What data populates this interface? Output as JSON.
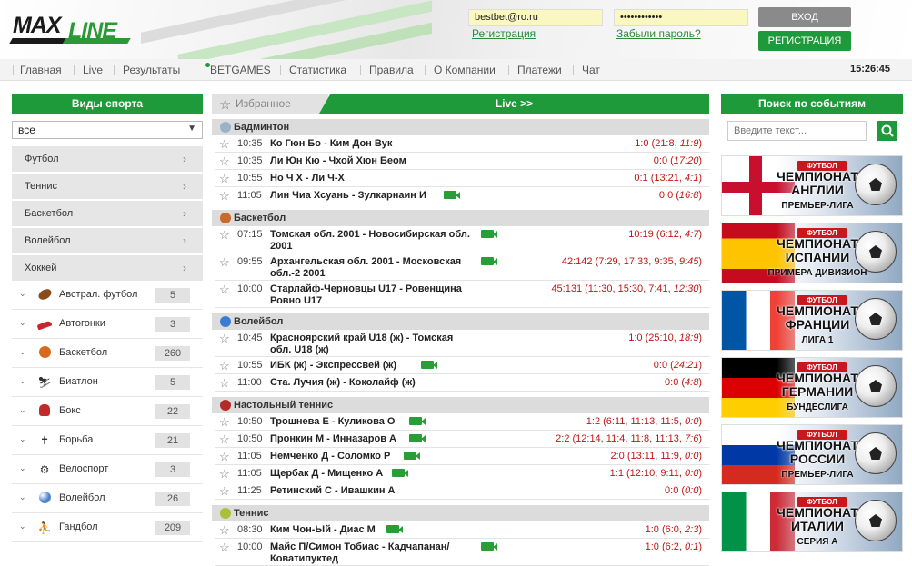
{
  "header": {
    "logo_max": "MAX",
    "logo_line": "LINE",
    "login_value": "bestbet@ro.ru",
    "password_value": "••••••••••••",
    "register_link": "Регистрация",
    "forgot_link": "Забыли пароль?",
    "login_button": "ВХОД",
    "register_button": "РЕГИСТРАЦИЯ",
    "colors": {
      "accent": "#1f9a3a",
      "login_btn": "#8a8a8a",
      "input_bg": "#fbf7c0"
    }
  },
  "nav": {
    "items": [
      "Главная",
      "Live",
      "Результаты",
      "BETGAMES",
      "Статистика",
      "Правила",
      "О Компании",
      "Платежи",
      "Чат"
    ],
    "clock": "15:26:45"
  },
  "left": {
    "title": "Виды спорта",
    "select_value": "все",
    "categories": [
      "Футбол",
      "Теннис",
      "Баскетбол",
      "Волейбол",
      "Хоккей"
    ],
    "sports": [
      {
        "label": "Австрал. футбол",
        "count": "5",
        "icon": "rugby-ball-icon"
      },
      {
        "label": "Автогонки",
        "count": "3",
        "icon": "race-car-icon"
      },
      {
        "label": "Баскетбол",
        "count": "260",
        "icon": "basketball-icon"
      },
      {
        "label": "Биатлон",
        "count": "5",
        "icon": "biathlon-icon"
      },
      {
        "label": "Бокс",
        "count": "22",
        "icon": "boxing-glove-icon"
      },
      {
        "label": "Борьба",
        "count": "21",
        "icon": "wrestling-icon"
      },
      {
        "label": "Велоспорт",
        "count": "3",
        "icon": "bicycle-icon"
      },
      {
        "label": "Волейбол",
        "count": "26",
        "icon": "volleyball-icon"
      },
      {
        "label": "Гандбол",
        "count": "209",
        "icon": "handball-icon"
      }
    ]
  },
  "mid": {
    "tab_fav": "Избранное",
    "tab_live": "Live >>",
    "sections": [
      {
        "title": "Бадминтон",
        "events": [
          {
            "time": "10:35",
            "teams": "Ко Гюн Бо - Ким Дон Вук",
            "score": "1:0 (21:8, ",
            "score_live": "11:9",
            "score_end": ")",
            "video": false
          },
          {
            "time": "10:35",
            "teams": "Ли Юн Кю - Чхой Хюн Беом",
            "score": "0:0 (",
            "score_live": "17:20",
            "score_end": ")",
            "video": false
          },
          {
            "time": "10:55",
            "teams": "Но Ч Х - Ли Ч-Х",
            "score": "0:1 (13:21, ",
            "score_live": "4:1",
            "score_end": ")",
            "video": false
          },
          {
            "time": "11:05",
            "teams": "Лин Чиа Хсуань - Зулкарнаин И",
            "score": "0:0 (",
            "score_live": "16:8",
            "score_end": ")",
            "video": true
          }
        ]
      },
      {
        "title": "Баскетбол",
        "events": [
          {
            "time": "07:15",
            "teams": "Томская обл. 2001 - Новосибирская обл. 2001",
            "score": "10:19 (6:12, ",
            "score_live": "4:7",
            "score_end": ")",
            "video": true
          },
          {
            "time": "09:55",
            "teams": "Архангельская обл. 2001 - Московская обл.-2 2001",
            "score": "42:142 (7:29, 17:33, 9:35, ",
            "score_live": "9:45",
            "score_end": ")",
            "video": true
          },
          {
            "time": "10:00",
            "teams": "Старлайф-Черновцы U17 - Ровенщина Ровно U17",
            "score": "45:131 (11:30, 15:30, 7:41, ",
            "score_live": "12:30",
            "score_end": ")",
            "video": false
          }
        ]
      },
      {
        "title": "Волейбол",
        "events": [
          {
            "time": "10:45",
            "teams": "Красноярский край U18 (ж) - Томская обл. U18 (ж)",
            "score": "1:0 (25:10, ",
            "score_live": "18:9",
            "score_end": ")",
            "video": false
          },
          {
            "time": "10:55",
            "teams": "ИБК (ж) - Экспрессвей (ж)",
            "score": "0:0 (",
            "score_live": "24:21",
            "score_end": ")",
            "video": true
          },
          {
            "time": "11:00",
            "teams": "Ста. Лучия (ж) - Коколайф (ж)",
            "score": "0:0 (",
            "score_live": "4:8",
            "score_end": ")",
            "video": false
          }
        ]
      },
      {
        "title": "Настольный теннис",
        "events": [
          {
            "time": "10:50",
            "teams": "Трошнева Е - Куликова О",
            "score": "1:2 (6:11, 11:13, 11:5, ",
            "score_live": "0:0",
            "score_end": ")",
            "video": true
          },
          {
            "time": "10:50",
            "teams": "Пронкин М - Инназаров А",
            "score": "2:2 (12:14, 11:4, 11:8, 11:13, ",
            "score_live": "7:6",
            "score_end": ")",
            "video": true
          },
          {
            "time": "11:05",
            "teams": "Немченко Д - Соломко Р",
            "score": "2:0 (13:11, 11:9, ",
            "score_live": "0:0",
            "score_end": ")",
            "video": true
          },
          {
            "time": "11:05",
            "teams": "Щербак Д - Мищенко А",
            "score": "1:1 (12:10, 9:11, ",
            "score_live": "0:0",
            "score_end": ")",
            "video": true
          },
          {
            "time": "11:25",
            "teams": "Ретинский С - Ивашкин А",
            "score": "0:0 (",
            "score_live": "0:0",
            "score_end": ")",
            "video": false
          }
        ]
      },
      {
        "title": "Теннис",
        "events": [
          {
            "time": "08:30",
            "teams": "Ким Чон-Ый - Диас М",
            "score": "1:0 (6:0, ",
            "score_live": "2:3",
            "score_end": ")",
            "video": true
          },
          {
            "time": "10:00",
            "teams": "Майс П/Симон Тобиас - Кадчапанан/ Коватипуктед",
            "score": "1:0 (6:2, ",
            "score_live": "0:1",
            "score_end": ")",
            "video": true
          }
        ]
      }
    ]
  },
  "right": {
    "title": "Поиск по событиям",
    "search_placeholder": "Введите текст...",
    "banners": [
      {
        "tag": "ФУТБОЛ",
        "title": "ЧЕМПИОНАТ АНГЛИИ",
        "sub": "ПРЕМЬЕР-ЛИГА",
        "flag": "england"
      },
      {
        "tag": "ФУТБОЛ",
        "title": "ЧЕМПИОНАТ ИСПАНИИ",
        "sub": "ПРИМЕРА ДИВИЗИОН",
        "flag": "spain"
      },
      {
        "tag": "ФУТБОЛ",
        "title": "ЧЕМПИОНАТ ФРАНЦИИ",
        "sub": "ЛИГА 1",
        "flag": "france"
      },
      {
        "tag": "ФУТБОЛ",
        "title": "ЧЕМПИОНАТ ГЕРМАНИИ",
        "sub": "БУНДЕСЛИГА",
        "flag": "germany"
      },
      {
        "tag": "ФУТБОЛ",
        "title": "ЧЕМПИОНАТ РОССИИ",
        "sub": "ПРЕМЬЕР-ЛИГА",
        "flag": "russia"
      },
      {
        "tag": "ФУТБОЛ",
        "title": "ЧЕМПИОНАТ ИТАЛИИ",
        "sub": "СЕРИЯ А",
        "flag": "italy"
      }
    ]
  }
}
